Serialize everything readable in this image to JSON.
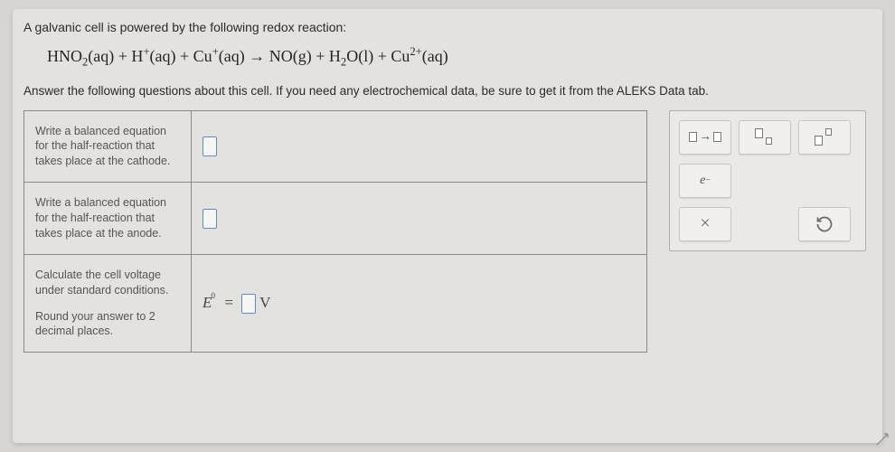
{
  "title": "A galvanic cell is powered by the following redox reaction:",
  "equation_html": "HNO<sub>2</sub>(aq) + H<sup>+</sup>(aq) + Cu<sup>+</sup>(aq) → NO(g) + H<sub>2</sub>O(l) + Cu<sup>2+</sup>(aq)",
  "instructions": "Answer the following questions about this cell. If you need any electrochemical data, be sure to get it from the ALEKS Data tab.",
  "prompts": {
    "cathode": "Write a balanced equation for the half-reaction that takes place at the cathode.",
    "anode": "Write a balanced equation for the half-reaction that takes place at the anode.",
    "voltage_a": "Calculate the cell voltage under standard conditions.",
    "voltage_b": "Round your answer to 2 decimal places."
  },
  "evolt": {
    "E": "E",
    "zero": "0",
    "eq": "=",
    "unit": "V"
  },
  "palette": {
    "arrow": "→",
    "electron": "e",
    "electron_sup": "−",
    "close": "×"
  }
}
